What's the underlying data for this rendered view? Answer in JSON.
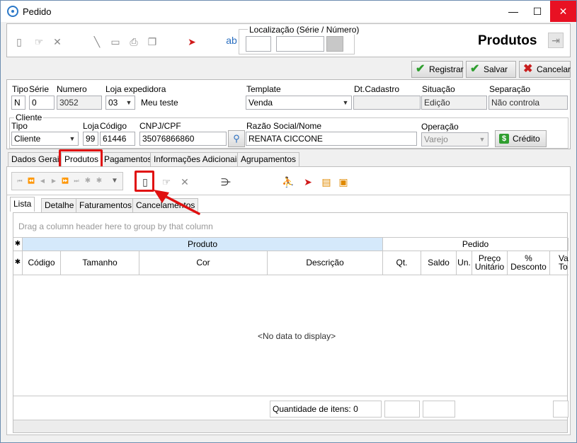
{
  "window": {
    "title": "Pedido",
    "minimize": "—",
    "maximize": "☐",
    "close": "✕"
  },
  "top_toolbar": {
    "localizacao_label": "Localização (Série / Número)",
    "heading": "Produtos"
  },
  "actions": {
    "registrar": "Registrar",
    "salvar": "Salvar",
    "cancelar": "Cancelar"
  },
  "form": {
    "tipo_label": "Tipo",
    "tipo_value": "N",
    "serie_label": "Série",
    "serie_value": "0",
    "numero_label": "Numero",
    "numero_value": "3052",
    "loja_exp_label": "Loja expedidora",
    "loja_exp_value": "03",
    "loja_exp_name": "Meu teste",
    "template_label": "Template",
    "template_value": "Venda",
    "dt_cadastro_label": "Dt.Cadastro",
    "dt_cadastro_value": "",
    "situacao_label": "Situação",
    "situacao_value": "Edição",
    "separacao_label": "Separação",
    "separacao_value": "Não controla"
  },
  "cliente": {
    "group_label": "Cliente",
    "tipo_label": "Tipo",
    "tipo_value": "Cliente",
    "loja_label": "Loja",
    "loja_value": "99",
    "codigo_label": "Código",
    "codigo_value": "61446",
    "cnpj_label": "CNPJ/CPF",
    "cnpj_value": "35076866860",
    "razao_label": "Razão Social/Nome",
    "razao_value": "RENATA CICCONE",
    "operacao_label": "Operação",
    "operacao_value": "Varejo",
    "credito": "Crédito"
  },
  "main_tabs": [
    "Dados Gerais",
    "Produtos",
    "Pagamentos",
    "Informações Adicionais",
    "Agrupamentos"
  ],
  "sub_tabs": [
    "Lista",
    "Detalhe",
    "Faturamentos",
    "Cancelamentos"
  ],
  "grid": {
    "group_hint": "Drag a column header here to group by that column",
    "band_produto": "Produto",
    "band_pedido": "Pedido",
    "columns": {
      "codigo": "Código",
      "tamanho": "Tamanho",
      "cor": "Cor",
      "descricao": "Descrição",
      "qt": "Qt.",
      "saldo": "Saldo",
      "un": "Un.",
      "preco_1": "Preço",
      "preco_2": "Unitário",
      "desc_1": "%",
      "desc_2": "Desconto",
      "va_1": "Va",
      "va_2": "To"
    },
    "empty": "<No data to display>",
    "footer_qty": "Quantidade de itens: 0"
  }
}
